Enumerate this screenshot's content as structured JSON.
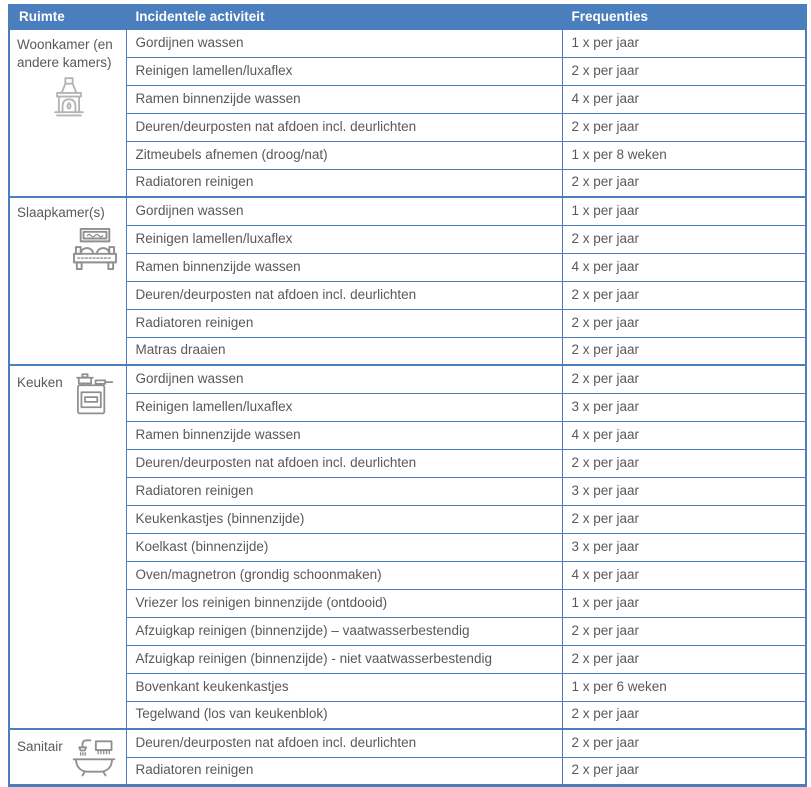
{
  "colors": {
    "header_bg": "#4a7ebd",
    "border": "#4a7ebd",
    "header_text": "#ffffff",
    "cell_text": "#595959",
    "icon_gray": "#8f8f8f",
    "icon_light_gray": "#b4b4b4"
  },
  "table": {
    "columns": [
      "Ruimte",
      "Incidentele activiteit",
      "Frequenties"
    ],
    "groups": [
      {
        "room": "Woonkamer (en andere kamers)",
        "icon": "fireplace-icon",
        "rows": [
          {
            "activity": "Gordijnen wassen",
            "frequency": "1 x per jaar"
          },
          {
            "activity": "Reinigen lamellen/luxaflex",
            "frequency": "2 x per jaar"
          },
          {
            "activity": "Ramen binnenzijde wassen",
            "frequency": "4 x per jaar"
          },
          {
            "activity": "Deuren/deurposten nat afdoen incl. deurlichten",
            "frequency": "2 x per jaar"
          },
          {
            "activity": "Zitmeubels afnemen (droog/nat)",
            "frequency": "1 x per 8 weken"
          },
          {
            "activity": "Radiatoren reinigen",
            "frequency": "2 x per jaar"
          }
        ]
      },
      {
        "room": "Slaapkamer(s)",
        "icon": "bed-icon",
        "rows": [
          {
            "activity": "Gordijnen wassen",
            "frequency": "1 x per jaar"
          },
          {
            "activity": "Reinigen lamellen/luxaflex",
            "frequency": "2 x per jaar"
          },
          {
            "activity": "Ramen binnenzijde wassen",
            "frequency": "4 x per jaar"
          },
          {
            "activity": "Deuren/deurposten nat afdoen incl. deurlichten",
            "frequency": "2 x per jaar"
          },
          {
            "activity": "Radiatoren reinigen",
            "frequency": "2 x per jaar"
          },
          {
            "activity": "Matras draaien",
            "frequency": "2 x per jaar"
          }
        ]
      },
      {
        "room": "Keuken",
        "icon": "stove-icon",
        "rows": [
          {
            "activity": "Gordijnen wassen",
            "frequency": "2 x per jaar"
          },
          {
            "activity": "Reinigen lamellen/luxaflex",
            "frequency": "3 x per jaar"
          },
          {
            "activity": "Ramen binnenzijde wassen",
            "frequency": "4 x per jaar"
          },
          {
            "activity": "Deuren/deurposten nat afdoen incl. deurlichten",
            "frequency": "2 x per jaar"
          },
          {
            "activity": "Radiatoren reinigen",
            "frequency": "3 x per jaar"
          },
          {
            "activity": "Keukenkastjes (binnenzijde)",
            "frequency": "2 x per jaar"
          },
          {
            "activity": "Koelkast (binnenzijde)",
            "frequency": "3 x per jaar"
          },
          {
            "activity": "Oven/magnetron (grondig schoonmaken)",
            "frequency": "4 x per jaar"
          },
          {
            "activity": "Vriezer los reinigen binnenzijde (ontdooid)",
            "frequency": "1 x per jaar"
          },
          {
            "activity": "Afzuigkap reinigen (binnenzijde) – vaatwasserbestendig",
            "frequency": "2 x per jaar"
          },
          {
            "activity": "Afzuigkap reinigen (binnenzijde) - niet vaatwasserbestendig",
            "frequency": "2 x per jaar"
          },
          {
            "activity": "Bovenkant keukenkastjes",
            "frequency": "1 x per 6 weken"
          },
          {
            "activity": "Tegelwand (los van keukenblok)",
            "frequency": "2 x per jaar"
          }
        ]
      },
      {
        "room": "Sanitair",
        "icon": "bathtub-icon",
        "rows": [
          {
            "activity": "Deuren/deurposten nat afdoen incl. deurlichten",
            "frequency": "2 x per jaar"
          },
          {
            "activity": "Radiatoren reinigen",
            "frequency": "2 x per jaar"
          }
        ]
      }
    ]
  }
}
